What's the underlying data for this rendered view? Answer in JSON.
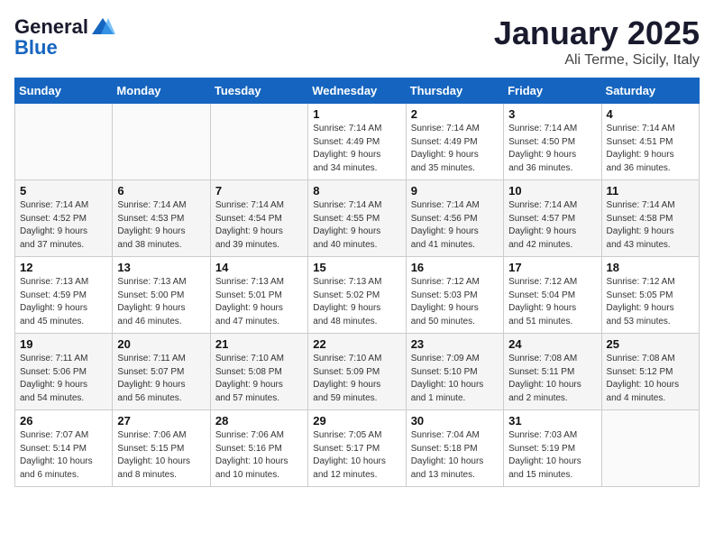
{
  "logo": {
    "general": "General",
    "blue": "Blue"
  },
  "title": "January 2025",
  "subtitle": "Ali Terme, Sicily, Italy",
  "days_of_week": [
    "Sunday",
    "Monday",
    "Tuesday",
    "Wednesday",
    "Thursday",
    "Friday",
    "Saturday"
  ],
  "weeks": [
    [
      {
        "day": "",
        "info": ""
      },
      {
        "day": "",
        "info": ""
      },
      {
        "day": "",
        "info": ""
      },
      {
        "day": "1",
        "info": "Sunrise: 7:14 AM\nSunset: 4:49 PM\nDaylight: 9 hours\nand 34 minutes."
      },
      {
        "day": "2",
        "info": "Sunrise: 7:14 AM\nSunset: 4:49 PM\nDaylight: 9 hours\nand 35 minutes."
      },
      {
        "day": "3",
        "info": "Sunrise: 7:14 AM\nSunset: 4:50 PM\nDaylight: 9 hours\nand 36 minutes."
      },
      {
        "day": "4",
        "info": "Sunrise: 7:14 AM\nSunset: 4:51 PM\nDaylight: 9 hours\nand 36 minutes."
      }
    ],
    [
      {
        "day": "5",
        "info": "Sunrise: 7:14 AM\nSunset: 4:52 PM\nDaylight: 9 hours\nand 37 minutes."
      },
      {
        "day": "6",
        "info": "Sunrise: 7:14 AM\nSunset: 4:53 PM\nDaylight: 9 hours\nand 38 minutes."
      },
      {
        "day": "7",
        "info": "Sunrise: 7:14 AM\nSunset: 4:54 PM\nDaylight: 9 hours\nand 39 minutes."
      },
      {
        "day": "8",
        "info": "Sunrise: 7:14 AM\nSunset: 4:55 PM\nDaylight: 9 hours\nand 40 minutes."
      },
      {
        "day": "9",
        "info": "Sunrise: 7:14 AM\nSunset: 4:56 PM\nDaylight: 9 hours\nand 41 minutes."
      },
      {
        "day": "10",
        "info": "Sunrise: 7:14 AM\nSunset: 4:57 PM\nDaylight: 9 hours\nand 42 minutes."
      },
      {
        "day": "11",
        "info": "Sunrise: 7:14 AM\nSunset: 4:58 PM\nDaylight: 9 hours\nand 43 minutes."
      }
    ],
    [
      {
        "day": "12",
        "info": "Sunrise: 7:13 AM\nSunset: 4:59 PM\nDaylight: 9 hours\nand 45 minutes."
      },
      {
        "day": "13",
        "info": "Sunrise: 7:13 AM\nSunset: 5:00 PM\nDaylight: 9 hours\nand 46 minutes."
      },
      {
        "day": "14",
        "info": "Sunrise: 7:13 AM\nSunset: 5:01 PM\nDaylight: 9 hours\nand 47 minutes."
      },
      {
        "day": "15",
        "info": "Sunrise: 7:13 AM\nSunset: 5:02 PM\nDaylight: 9 hours\nand 48 minutes."
      },
      {
        "day": "16",
        "info": "Sunrise: 7:12 AM\nSunset: 5:03 PM\nDaylight: 9 hours\nand 50 minutes."
      },
      {
        "day": "17",
        "info": "Sunrise: 7:12 AM\nSunset: 5:04 PM\nDaylight: 9 hours\nand 51 minutes."
      },
      {
        "day": "18",
        "info": "Sunrise: 7:12 AM\nSunset: 5:05 PM\nDaylight: 9 hours\nand 53 minutes."
      }
    ],
    [
      {
        "day": "19",
        "info": "Sunrise: 7:11 AM\nSunset: 5:06 PM\nDaylight: 9 hours\nand 54 minutes."
      },
      {
        "day": "20",
        "info": "Sunrise: 7:11 AM\nSunset: 5:07 PM\nDaylight: 9 hours\nand 56 minutes."
      },
      {
        "day": "21",
        "info": "Sunrise: 7:10 AM\nSunset: 5:08 PM\nDaylight: 9 hours\nand 57 minutes."
      },
      {
        "day": "22",
        "info": "Sunrise: 7:10 AM\nSunset: 5:09 PM\nDaylight: 9 hours\nand 59 minutes."
      },
      {
        "day": "23",
        "info": "Sunrise: 7:09 AM\nSunset: 5:10 PM\nDaylight: 10 hours\nand 1 minute."
      },
      {
        "day": "24",
        "info": "Sunrise: 7:08 AM\nSunset: 5:11 PM\nDaylight: 10 hours\nand 2 minutes."
      },
      {
        "day": "25",
        "info": "Sunrise: 7:08 AM\nSunset: 5:12 PM\nDaylight: 10 hours\nand 4 minutes."
      }
    ],
    [
      {
        "day": "26",
        "info": "Sunrise: 7:07 AM\nSunset: 5:14 PM\nDaylight: 10 hours\nand 6 minutes."
      },
      {
        "day": "27",
        "info": "Sunrise: 7:06 AM\nSunset: 5:15 PM\nDaylight: 10 hours\nand 8 minutes."
      },
      {
        "day": "28",
        "info": "Sunrise: 7:06 AM\nSunset: 5:16 PM\nDaylight: 10 hours\nand 10 minutes."
      },
      {
        "day": "29",
        "info": "Sunrise: 7:05 AM\nSunset: 5:17 PM\nDaylight: 10 hours\nand 12 minutes."
      },
      {
        "day": "30",
        "info": "Sunrise: 7:04 AM\nSunset: 5:18 PM\nDaylight: 10 hours\nand 13 minutes."
      },
      {
        "day": "31",
        "info": "Sunrise: 7:03 AM\nSunset: 5:19 PM\nDaylight: 10 hours\nand 15 minutes."
      },
      {
        "day": "",
        "info": ""
      }
    ]
  ]
}
